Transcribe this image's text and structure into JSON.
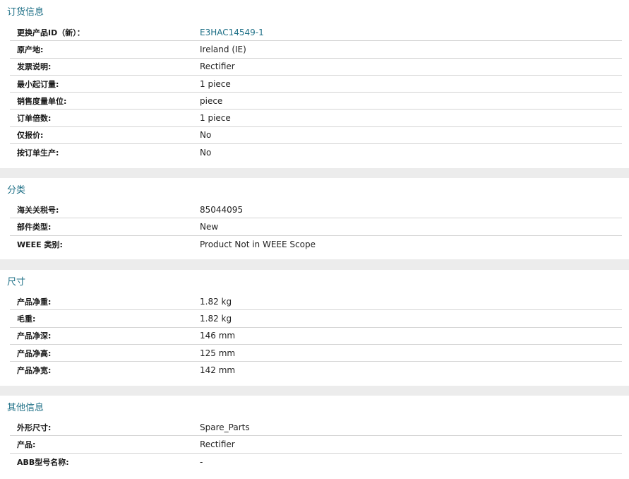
{
  "sections": {
    "order": {
      "title": "订货信息",
      "rows": [
        {
          "label": "更换产品ID（新）：",
          "value": "E3HAC14549-1"
        },
        {
          "label": "原产地:",
          "value": "Ireland (IE)"
        },
        {
          "label": "发票说明:",
          "value": "Rectifier"
        },
        {
          "label": "最小起订量:",
          "value": "1 piece"
        },
        {
          "label": "销售度量单位:",
          "value": "piece"
        },
        {
          "label": "订单倍数:",
          "value": "1 piece"
        },
        {
          "label": "仅报价:",
          "value": "No"
        },
        {
          "label": "按订单生产:",
          "value": "No"
        }
      ]
    },
    "classification": {
      "title": "分类",
      "rows": [
        {
          "label": "海关关税号:",
          "value": "85044095"
        },
        {
          "label": "部件类型:",
          "value": "New"
        },
        {
          "label": "WEEE 类别:",
          "value": "Product Not in WEEE Scope"
        }
      ]
    },
    "dimensions": {
      "title": "尺寸",
      "rows": [
        {
          "label": "产品净重:",
          "value": "1.82 kg"
        },
        {
          "label": "毛重:",
          "value": "1.82 kg"
        },
        {
          "label": "产品净深:",
          "value": "146 mm"
        },
        {
          "label": "产品净高:",
          "value": "125 mm"
        },
        {
          "label": "产品净宽:",
          "value": "142 mm"
        }
      ]
    },
    "other": {
      "title": "其他信息",
      "rows": [
        {
          "label": "外形尺寸:",
          "value": "Spare_Parts"
        },
        {
          "label": "产品:",
          "value": "Rectifier"
        },
        {
          "label": "ABB型号名称:",
          "value": "-"
        }
      ]
    }
  }
}
